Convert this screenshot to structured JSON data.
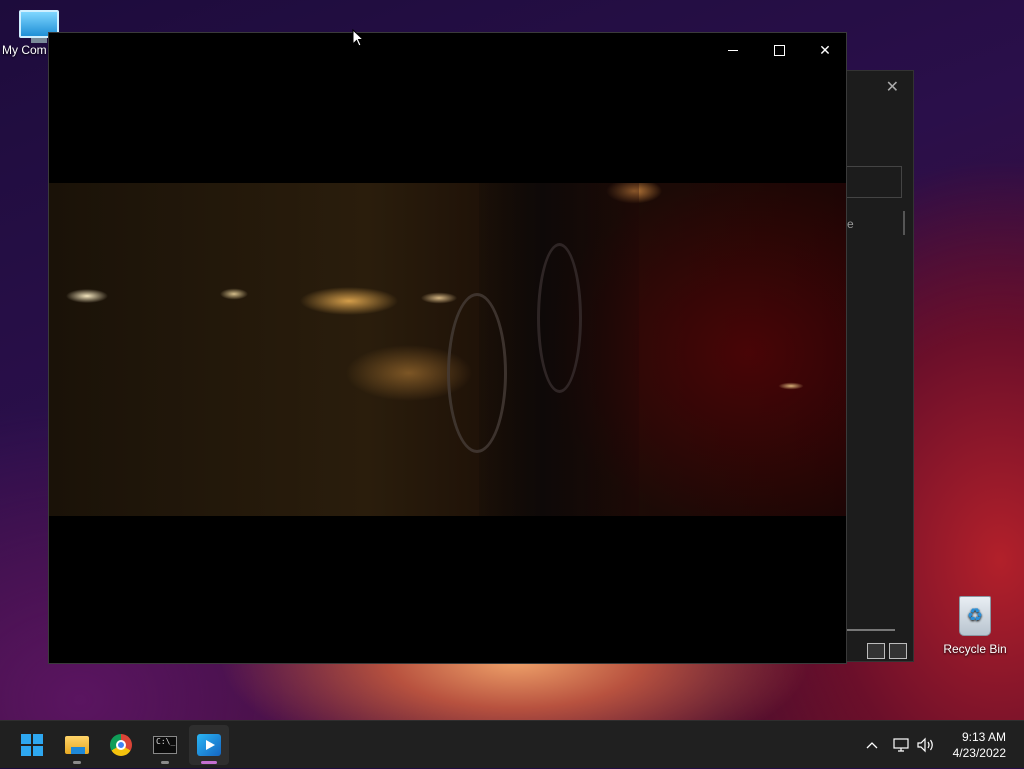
{
  "desktop": {
    "icons": [
      {
        "label": "My Com",
        "icon": "computer-icon"
      },
      {
        "label": "Recycle Bin",
        "icon": "recycle-bin-icon"
      }
    ]
  },
  "background_window": {
    "partial_label": "e",
    "close_glyph": "✕"
  },
  "player_window": {
    "minimize_glyph": "",
    "close_glyph": "✕"
  },
  "taskbar": {
    "apps": [
      {
        "name": "Start",
        "icon": "windows-start-icon"
      },
      {
        "name": "File Explorer",
        "icon": "folder-icon"
      },
      {
        "name": "Google Chrome",
        "icon": "chrome-icon"
      },
      {
        "name": "Command Prompt",
        "icon": "terminal-icon",
        "glyph": "C:\\_"
      },
      {
        "name": "Media Player",
        "icon": "media-player-icon"
      }
    ],
    "tray": {
      "chevron": "^",
      "network": "network-icon",
      "volume": "volume-icon"
    },
    "clock": {
      "time": "9:13 AM",
      "date": "4/23/2022"
    }
  },
  "colors": {
    "taskbar_bg": "#202020",
    "active_indicator": "#c46fd1",
    "start_blue": "#2ea7f0"
  }
}
